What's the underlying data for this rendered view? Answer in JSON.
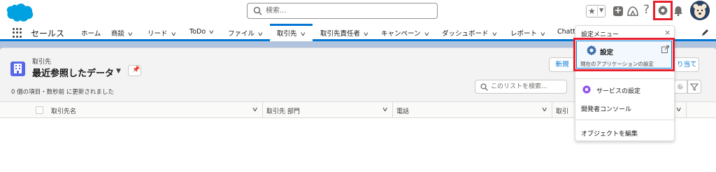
{
  "colors": {
    "brand_blue": "#0176d3",
    "highlight_red": "#e8202e",
    "object_icon": "#5867e8",
    "service_gear": "#9050e9",
    "setup_gear": "#3e6fa8"
  },
  "header": {
    "search_placeholder": "検索...",
    "help_symbol": "?",
    "icons": [
      "salesforce-cloud-logo",
      "search-icon",
      "star-icon",
      "add-icon",
      "trailhead-icon",
      "help-icon",
      "setup-gear-icon",
      "bell-icon",
      "avatar-icon"
    ]
  },
  "nav": {
    "app_name": "セールス",
    "items": [
      {
        "label": "ホーム",
        "chevron": false
      },
      {
        "label": "商談",
        "chevron": true
      },
      {
        "label": "リード",
        "chevron": true
      },
      {
        "label": "ToDo",
        "chevron": true
      },
      {
        "label": "ファイル",
        "chevron": true
      },
      {
        "label": "取引先",
        "chevron": true,
        "active": true
      },
      {
        "label": "取引先責任者",
        "chevron": true
      },
      {
        "label": "キャンペーン",
        "chevron": true
      },
      {
        "label": "ダッシュボード",
        "chevron": true
      },
      {
        "label": "レポート",
        "chevron": true
      },
      {
        "label": "Chatte",
        "chevron": false
      }
    ]
  },
  "list_view": {
    "object_label": "取引先",
    "title": "最近参照したデータ",
    "meta": "0 個の項目・数秒前 に更新されました",
    "new_button": "新規",
    "assign_button": "り当て",
    "search_placeholder": "このリストを検索...",
    "columns": [
      "取引先名",
      "取引先 部門",
      "電話",
      "取引"
    ]
  },
  "setup_menu": {
    "header": "設定メニュー",
    "close_symbol": "×",
    "setup_item": {
      "title": "設定",
      "subtitle": "現在のアプリケーションの設定"
    },
    "service_setup": "サービスの設定",
    "developer_console": "開発者コンソール",
    "edit_object": "オブジェクトを編集"
  }
}
